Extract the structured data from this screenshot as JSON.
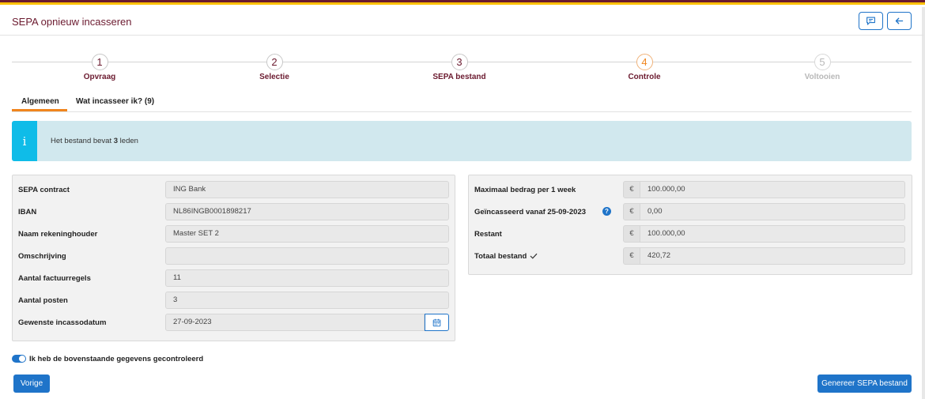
{
  "header": {
    "title": "SEPA opnieuw incasseren"
  },
  "stepper": {
    "steps": [
      {
        "number": "1",
        "label": "Opvraag"
      },
      {
        "number": "2",
        "label": "Selectie"
      },
      {
        "number": "3",
        "label": "SEPA bestand"
      },
      {
        "number": "4",
        "label": "Controle"
      },
      {
        "number": "5",
        "label": "Voltooien"
      }
    ],
    "current_step": 4
  },
  "tabs": [
    {
      "label": "Algemeen"
    },
    {
      "label": "Wat incasseer ik? (9)"
    }
  ],
  "alert": {
    "text_before": "Het bestand bevat ",
    "count": "3",
    "text_after": " leden"
  },
  "left_panel": {
    "rows": [
      {
        "label": "SEPA contract",
        "value": "ING Bank"
      },
      {
        "label": "IBAN",
        "value": "NL86INGB0001898217"
      },
      {
        "label": "Naam rekeninghouder",
        "value": "Master SET 2"
      },
      {
        "label": "Omschrijving",
        "value": ""
      },
      {
        "label": "Aantal factuurregels",
        "value": "11"
      },
      {
        "label": "Aantal posten",
        "value": "3"
      },
      {
        "label": "Gewenste incassodatum",
        "value": "27-09-2023"
      }
    ]
  },
  "right_panel": {
    "currency": "€",
    "rows": [
      {
        "label": "Maximaal bedrag per 1 week",
        "value": "100.000,00"
      },
      {
        "label": "Geïncasseerd vanaf 25-09-2023",
        "value": "0,00"
      },
      {
        "label": "Restant",
        "value": "100.000,00"
      },
      {
        "label": "Totaal bestand",
        "value": "420,72"
      }
    ],
    "help_glyph": "?"
  },
  "confirm": {
    "label": "Ik heb de bovenstaande gegevens gecontroleerd",
    "checked": true
  },
  "buttons": {
    "previous": "Vorige",
    "generate": "Genereer SEPA bestand"
  },
  "colors": {
    "brand": "#6b1a2f",
    "accent": "#f0851d",
    "primary": "#1f74c9",
    "info": "#0fbce8"
  }
}
